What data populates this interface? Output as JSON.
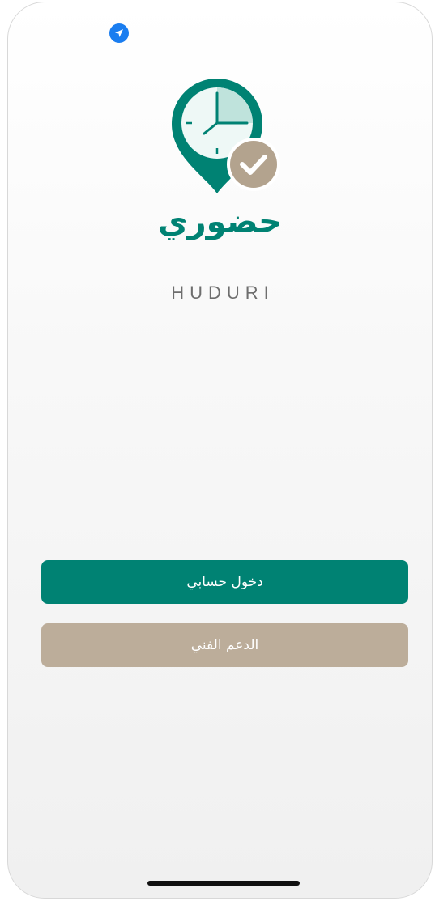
{
  "status_bar": {
    "location_icon": "location-arrow-icon",
    "accent_color": "#1a7df0"
  },
  "brand": {
    "logo_icon": "location-pin-clock-check-icon",
    "name_arabic": "حضوري",
    "name_latin": "HUDURI",
    "primary_color": "#008273",
    "secondary_color": "#bcad9a"
  },
  "actions": {
    "login_label": "دخول حسابي",
    "support_label": "الدعم الفني"
  }
}
